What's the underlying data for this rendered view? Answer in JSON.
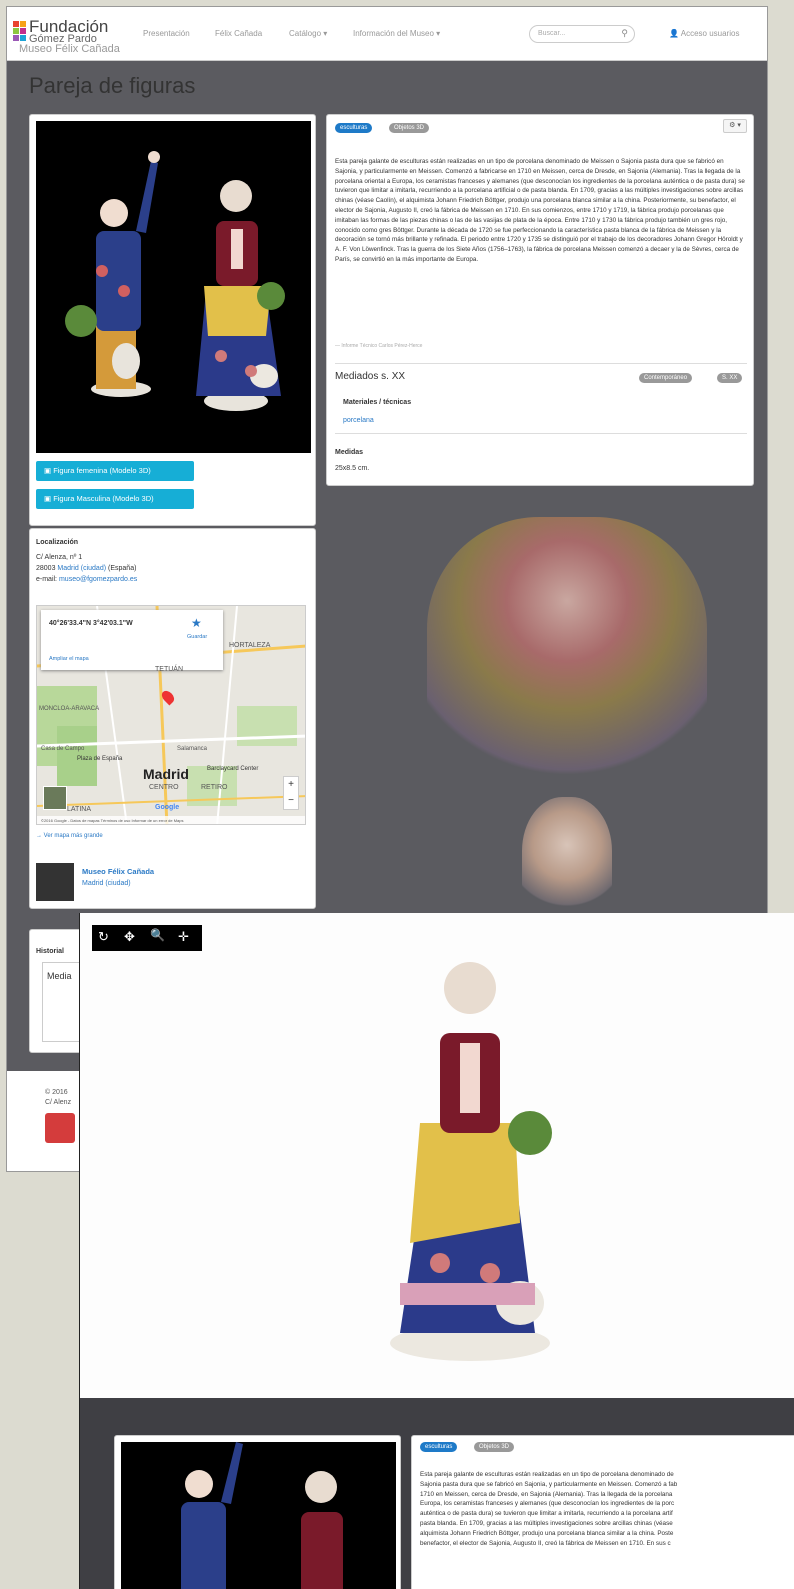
{
  "brand": {
    "line1": "Fundación",
    "line2": "Gómez Pardo",
    "line3": "Museo Félix Cañada"
  },
  "nav": {
    "items": [
      "Presentación",
      "Félix Cañada",
      "Catálogo ▾",
      "Información del Museo ▾"
    ],
    "search_placeholder": "Buscar...",
    "search_icon": "search-icon",
    "account": "Acceso usuarios"
  },
  "page": {
    "title": "Pareja de figuras"
  },
  "tags": {
    "primary": "esculturas",
    "secondary": "Objetos 3D",
    "gear": "⚙ ▾"
  },
  "description": "Esta pareja galante de esculturas están realizadas en un tipo de porcelana denominado de Meissen o Sajonia pasta dura que se fabricó en Sajonia, y particularmente en Meissen. Comenzó a fabricarse en 1710 en Meissen, cerca de Dresde, en Sajonia (Alemania). Tras la llegada de la porcelana oriental a Europa, los ceramistas franceses y alemanes (que desconocían los ingredientes de la porcelana auténtica o de pasta dura) se tuvieron que limitar a imitarla, recurriendo a la porcelana artificial o de pasta blanda. En 1709, gracias a las múltiples investigaciones sobre arcillas chinas (véase Caolín), el alquimista Johann Friedrich Böttger, produjo una porcelana blanca similar a la china. Posteriormente, su benefactor, el elector de Sajonia, Augusto II, creó la fábrica de Meissen en 1710. En sus comienzos, entre 1710 y 1719, la fábrica produjo porcelanas que imitaban las formas de las piezas chinas o las de las vasijas de plata de la época. Entre 1710 y 1730 la fábrica produjo también un gres rojo, conocido como gres Böttger. Durante la década de 1720 se fue perfeccionando la característica pasta blanca de la fábrica de Meissen y la decoración se tornó más brillante y refinada. El periodo entre 1720 y 1735 se distinguió por el trabajo de los decoradores Johann Gregor Höroldt y A. F. Von Löwenfinck. Tras la guerra de los Siete Años (1756–1763), la fábrica de porcelana Meissen comenzó a decaer y la de Sèvres, cerca de París, se convirtió en la más importante de Europa.",
  "source": "— Informe Técnico Carlos Pérez-Herce",
  "dating": {
    "label": "Mediados s. XX",
    "badge1": "Contemporáneo",
    "badge2": "S. XX"
  },
  "materials": {
    "title": "Materiales / técnicas",
    "value": "porcelana"
  },
  "medidas": {
    "title": "Medidas",
    "value": "25x8.5 cm."
  },
  "buttons": {
    "female": "Figura femenina (Modelo 3D)",
    "male": "Figura Masculina (Modelo 3D)"
  },
  "location": {
    "title": "Localización",
    "street": "C/ Alenza, nº 1",
    "city_prefix": "28003",
    "city_link": "Madrid (ciudad)",
    "city_suffix": "(España)",
    "email_label": "e-mail:",
    "email": "museo@fgomezpardo.es"
  },
  "map": {
    "coords": "40°26'33.4\"N 3°42'03.1\"W",
    "save": "Guardar",
    "enlarge": "Ampliar el mapa",
    "districts": [
      "TETUÁN",
      "HORTALEZA",
      "MONCLOA-ARAVACA",
      "Casa de Campo",
      "Plaza de España",
      "Madrid",
      "CENTRO",
      "RETIRO",
      "Barclaycard Center",
      "LATINA",
      "Salamanca"
    ],
    "footer": "©2016 Google - Datos de mapas   Términos de uso   Informar de un error de Maps",
    "google": "Google",
    "more": "→ Ver mapa más grande"
  },
  "museum": {
    "name": "Museo Félix Cañada",
    "city": "Madrid (ciudad)"
  },
  "historial": {
    "title": "Historial",
    "value": "Media"
  },
  "footer": {
    "copyright": "© 2016",
    "address": "C/ Alenz"
  },
  "viewer": {
    "tools": [
      "↻",
      "✥",
      "🔍",
      "✛"
    ]
  },
  "shot2": {
    "tag1": "esculturas",
    "tag2": "Objetos 3D",
    "lines": [
      "Esta pareja galante de esculturas están realizadas en un tipo de porcelana denominado de",
      "Sajonia pasta dura que se fabricó en Sajonia, y particularmente en Meissen. Comenzó a fab",
      "1710 en Meissen, cerca de Dresde, en Sajonia (Alemania). Tras la llegada de la porcelana",
      "Europa, los ceramistas franceses y alemanes (que desconocían los ingredientes de la porc",
      "auténtica o de pasta dura) se tuvieron que limitar a imitarla, recurriendo a la porcelana artif",
      "pasta blanda. En 1709, gracias a las múltiples investigaciones sobre arcillas chinas (véase",
      "alquimista Johann Friedrich Böttger, produjo una porcelana blanca similar a la china. Poste",
      "benefactor, el elector de Sajonia, Augusto II, creó la fábrica de Meissen en 1710. En sus c"
    ]
  }
}
